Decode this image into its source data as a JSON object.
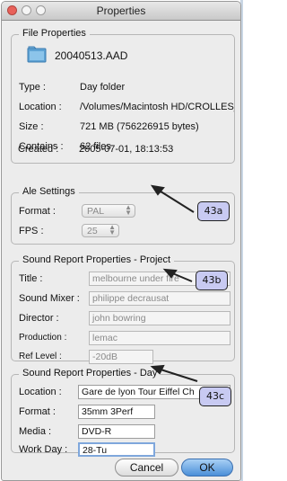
{
  "window": {
    "title": "Properties"
  },
  "file_properties": {
    "legend": "File Properties",
    "filename": "20040513.AAD",
    "rows": [
      {
        "label": "Type :",
        "value": "Day folder"
      },
      {
        "label": "Location :",
        "value": "/Volumes/Macintosh HD/CROLLES_.("
      },
      {
        "label": "Size :",
        "value": "721 MB (756226915 bytes)"
      },
      {
        "label": "Contains :",
        "value": "62 files"
      },
      {
        "label": "Created :",
        "value": "2005-07-01, 18:13:53"
      }
    ]
  },
  "ale_settings": {
    "legend": "Ale Settings",
    "format_label": "Format :",
    "format_value": "PAL",
    "fps_label": "FPS :",
    "fps_value": "25"
  },
  "sound_project": {
    "legend": "Sound Report Properties - Project",
    "title_label": "Title :",
    "title_value": "melbourne under fire",
    "mixer_label": "Sound Mixer :",
    "mixer_value": "philippe decrausat",
    "director_label": "Director :",
    "director_value": "john bowring",
    "production_label": "Production :",
    "production_value": "lemac",
    "ref_label": "Ref Level :",
    "ref_value": "-20dB"
  },
  "sound_day": {
    "legend": "Sound Report Properties - Day",
    "location_label": "Location :",
    "location_value": "Gare de lyon Tour Eiffel Ch",
    "format_label": "Format :",
    "format_value": "35mm 3Perf",
    "media_label": "Media :",
    "media_value": "DVD-R",
    "workday_label": "Work Day :",
    "workday_value": "28-Tu"
  },
  "buttons": {
    "cancel": "Cancel",
    "ok": "OK"
  },
  "callouts": {
    "a": "43a",
    "b": "43b",
    "c": "43c"
  },
  "colors": {
    "callout_fill": "#c8caf2",
    "ok_button": "#4b8fd8",
    "close_light": "#e8615a"
  },
  "icons": {
    "folder": "folder-icon"
  }
}
